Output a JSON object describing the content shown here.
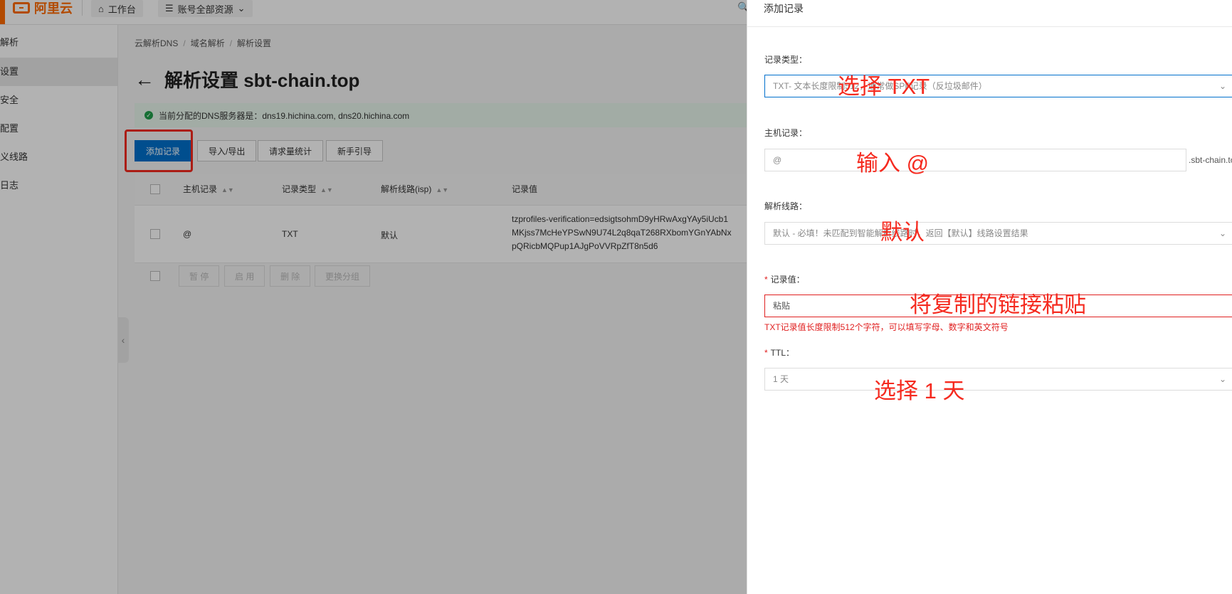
{
  "topnav": {
    "logo_text": "阿里云",
    "workbench": "工作台",
    "all_resources": "账号全部资源"
  },
  "sidebar": {
    "title": "解析",
    "items": [
      {
        "label": "设置",
        "active": true
      },
      {
        "label": "安全",
        "active": false
      },
      {
        "label": "配置",
        "active": false
      },
      {
        "label": "义线路",
        "active": false
      },
      {
        "label": "日志",
        "active": false
      }
    ]
  },
  "breadcrumb": [
    "云解析DNS",
    "域名解析",
    "解析设置"
  ],
  "page_title": "解析设置 sbt-chain.top",
  "dns_notice": "当前分配的DNS服务器是：dns19.hichina.com, dns20.hichina.com",
  "toolbar": {
    "add_record": "添加记录",
    "import_export": "导入/导出",
    "request_stats": "请求量统计",
    "beginner_guide": "新手引导"
  },
  "table": {
    "columns": [
      "主机记录",
      "记录类型",
      "解析线路(isp)",
      "记录值"
    ],
    "rows": [
      {
        "host": "@",
        "type": "TXT",
        "line": "默认",
        "value": "tzprofiles-verification=edsigtsohmD9yHRwAxgYAy5iUcb1MKjss7McHeYPSwN9U74L2q8qaT268RXbomYGnYAbNxpQRicbMQPup1AJgPoVVRpZfT8n5d6"
      }
    ],
    "bulk_actions": [
      "暂 停",
      "启 用",
      "删 除",
      "更换分组"
    ]
  },
  "drawer": {
    "title": "添加记录",
    "record_type": {
      "label": "记录类型：",
      "value": "TXT- 文本长度限制512，通常做SPF记录（反垃圾邮件）"
    },
    "host": {
      "label": "主机记录：",
      "value": "@",
      "suffix": ".sbt-chain.to"
    },
    "line": {
      "label": "解析线路：",
      "value": "默认 - 必填！未匹配到智能解析线路时，返回【默认】线路设置结果"
    },
    "record_value": {
      "label": "记录值：",
      "value": "粘贴",
      "error": "TXT记录值长度限制512个字符，可以填写字母、数字和英文符号"
    },
    "ttl": {
      "label": "TTL：",
      "value": "1 天"
    }
  },
  "annotations": {
    "select_txt": "选择 TXT",
    "input_at": "输入 @",
    "default": "默认",
    "paste_link": "将复制的链接粘贴",
    "select_1day": "选择 1 天"
  },
  "colors": {
    "primary": "#0070cc",
    "brand": "#ff6a00",
    "annotation_red": "#f52a1f",
    "success": "#20a04b"
  }
}
